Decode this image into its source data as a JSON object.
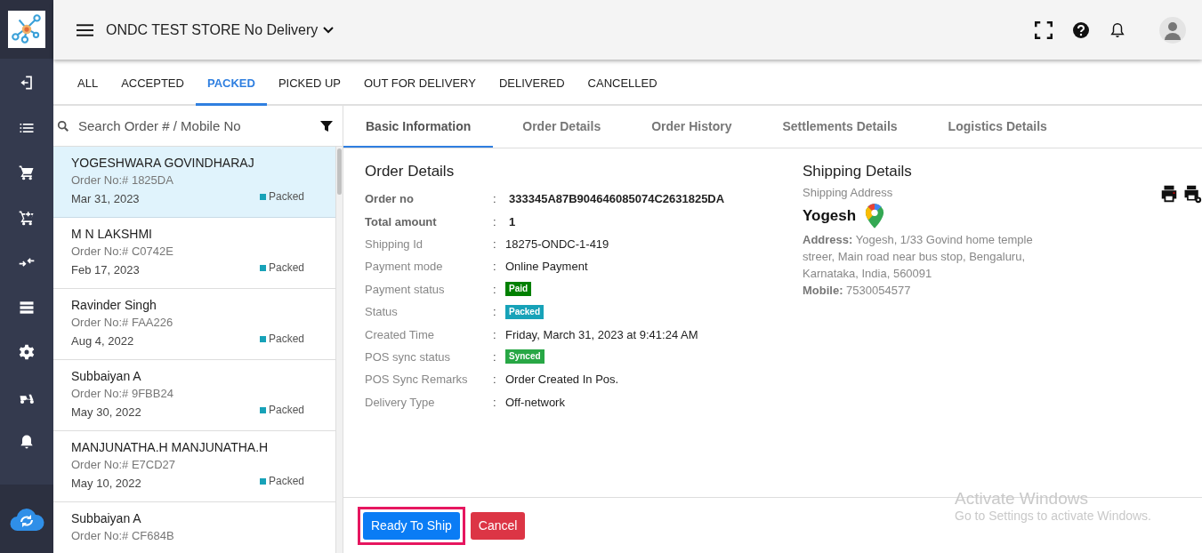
{
  "header": {
    "store_name": "ONDC TEST STORE No Delivery"
  },
  "status_tabs": [
    {
      "label": "ALL",
      "selected": false
    },
    {
      "label": "ACCEPTED",
      "selected": false
    },
    {
      "label": "PACKED",
      "selected": true
    },
    {
      "label": "PICKED UP",
      "selected": false
    },
    {
      "label": "OUT FOR DELIVERY",
      "selected": false
    },
    {
      "label": "DELIVERED",
      "selected": false
    },
    {
      "label": "CANCELLED",
      "selected": false
    }
  ],
  "search": {
    "placeholder": "Search Order # / Mobile No"
  },
  "orders": [
    {
      "name": "YOGESHWARA GOVINDHARAJ",
      "order_no": "Order No:# 1825DA",
      "date": "Mar 31, 2023",
      "status": "Packed",
      "selected": true
    },
    {
      "name": "M N LAKSHMI",
      "order_no": "Order No:# C0742E",
      "date": "Feb 17, 2023",
      "status": "Packed",
      "selected": false
    },
    {
      "name": "Ravinder Singh",
      "order_no": "Order No:# FAA226",
      "date": "Aug 4, 2022",
      "status": "Packed",
      "selected": false
    },
    {
      "name": "Subbaiyan A",
      "order_no": "Order No:# 9FBB24",
      "date": "May 30, 2022",
      "status": "Packed",
      "selected": false
    },
    {
      "name": "MANJUNATHA.H MANJUNATHA.H",
      "order_no": "Order No:# E7CD27",
      "date": "May 10, 2022",
      "status": "Packed",
      "selected": false
    },
    {
      "name": "Subbaiyan A",
      "order_no": "Order No:# CF684B",
      "selected": false
    }
  ],
  "detail_tabs": [
    {
      "label": "Basic Information",
      "selected": true
    },
    {
      "label": "Order Details",
      "selected": false
    },
    {
      "label": "Order History",
      "selected": false
    },
    {
      "label": "Settlements Details",
      "selected": false
    },
    {
      "label": "Logistics Details",
      "selected": false
    }
  ],
  "order_details": {
    "title": "Order Details",
    "rows": [
      {
        "label": "Order no",
        "separator": ":",
        "value": "333345A87B904646085074C2631825DA",
        "kind": "text",
        "bold": true
      },
      {
        "label": "Total amount",
        "separator": ":",
        "value": "1",
        "kind": "text",
        "bold": true
      },
      {
        "label": "Shipping Id",
        "separator": ":",
        "value": "18275-ONDC-1-419",
        "kind": "text",
        "bold": false
      },
      {
        "label": "Payment mode",
        "separator": ":",
        "value": "Online Payment",
        "kind": "text",
        "bold": false
      },
      {
        "label": "Payment status",
        "separator": ":",
        "value": "Paid",
        "kind": "badge",
        "bold": false,
        "color": "#008000"
      },
      {
        "label": "Status",
        "separator": ":",
        "value": "Packed",
        "kind": "badge",
        "bold": false,
        "color": "#17a2b8"
      },
      {
        "label": "Created Time",
        "separator": ":",
        "value": "Friday, March 31, 2023 at 9:41:24 AM",
        "kind": "text",
        "bold": false
      },
      {
        "label": "POS sync status",
        "separator": ":",
        "value": "Synced",
        "kind": "badge",
        "bold": false,
        "color": "#28a745"
      },
      {
        "label": "POS Sync Remarks",
        "separator": ":",
        "value": "Order Created In Pos.",
        "kind": "text",
        "bold": false
      },
      {
        "label": "Delivery Type",
        "separator": ":",
        "value": "Off-network",
        "kind": "text",
        "bold": false
      }
    ]
  },
  "shipping_details": {
    "title": "Shipping Details",
    "subtitle": "Shipping Address",
    "recipient": "Yogesh",
    "address": "**Address:** Yogesh, 1/33 Govind home temple streer, Main road near bus stop, Bengaluru, Karnataka, India, 560091",
    "mobile": "**Mobile:** 7530054577"
  },
  "actions": [
    {
      "label": "Ready To Ship",
      "kind": "primary",
      "highlighted": true
    },
    {
      "label": "Cancel",
      "kind": "danger",
      "highlighted": false
    }
  ],
  "os_overlay": {
    "title": "Activate Windows",
    "subtitle": "Go to Settings to activate Windows."
  }
}
